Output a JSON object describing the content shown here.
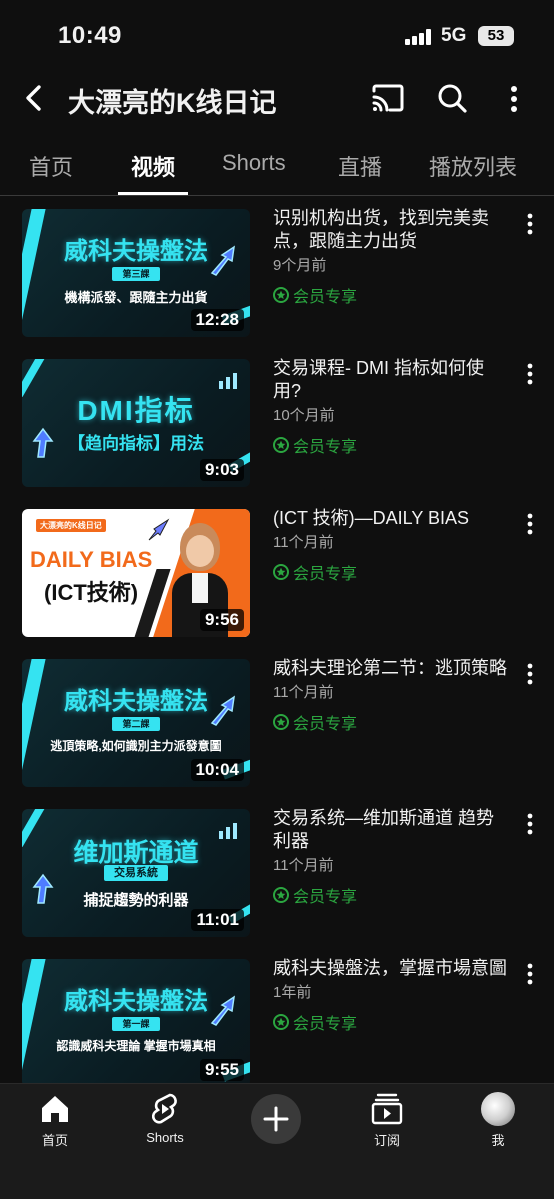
{
  "status_bar": {
    "time": "10:49",
    "network": "5G",
    "battery": "53"
  },
  "header": {
    "channel_title": "大漂亮的K线日记"
  },
  "tabs": [
    {
      "label": "首页",
      "active": false
    },
    {
      "label": "视频",
      "active": true
    },
    {
      "label": "Shorts",
      "active": false
    },
    {
      "label": "直播",
      "active": false
    },
    {
      "label": "播放列表",
      "active": false
    }
  ],
  "videos": [
    {
      "title": "识别机构出货，找到完美卖点，跟随主力出货",
      "age": "9个月前",
      "badge": "会员专享",
      "duration": "12:28",
      "thumb": {
        "title": "威科夫操盤法",
        "badge": "第三課",
        "sub": "機構派發、跟隨主力出貨"
      }
    },
    {
      "title": "交易课程- DMI 指标如何使用?",
      "age": "10个月前",
      "badge": "会员专享",
      "duration": "9:03",
      "thumb": {
        "title": "DMI指标",
        "sub": "【趋向指标】用法"
      }
    },
    {
      "title": "(ICT 技術)—DAILY BIAS",
      "age": "11个月前",
      "badge": "会员专享",
      "duration": "9:56",
      "thumb": {
        "tag": "大漂亮的K线日记",
        "title": "DAILY BIAS",
        "sub": "(ICT技術)"
      }
    },
    {
      "title": "威科夫理论第二节：逃顶策略",
      "age": "11个月前",
      "badge": "会员专享",
      "duration": "10:04",
      "thumb": {
        "title": "威科夫操盤法",
        "badge": "第二課",
        "sub": "逃頂策略,如何識別主力派發意圖"
      }
    },
    {
      "title": "交易系统—维加斯通道 趋势利器",
      "age": "11个月前",
      "badge": "会员专享",
      "duration": "11:01",
      "thumb": {
        "title": "维加斯通道",
        "badge": "交易系統",
        "sub": "捕捉趨勢的利器"
      }
    },
    {
      "title": "威科夫操盤法，掌握市場意圖",
      "age": "1年前",
      "badge": "会员专享",
      "duration": "9:55",
      "thumb": {
        "title": "威科夫操盤法",
        "badge": "第一課",
        "sub": "認識威科夫理論 掌握市場真相"
      }
    }
  ],
  "bottom_nav": [
    {
      "label": "首页",
      "icon": "home-icon"
    },
    {
      "label": "Shorts",
      "icon": "shorts-icon"
    },
    {
      "label": "",
      "icon": "create-icon"
    },
    {
      "label": "订阅",
      "icon": "subscriptions-icon"
    },
    {
      "label": "我",
      "icon": "avatar"
    }
  ],
  "colors": {
    "background": "#0f0f0f",
    "member_green": "#2ba640",
    "thumb_cyan": "#35e3f1",
    "thumb_orange": "#f26a1b"
  }
}
